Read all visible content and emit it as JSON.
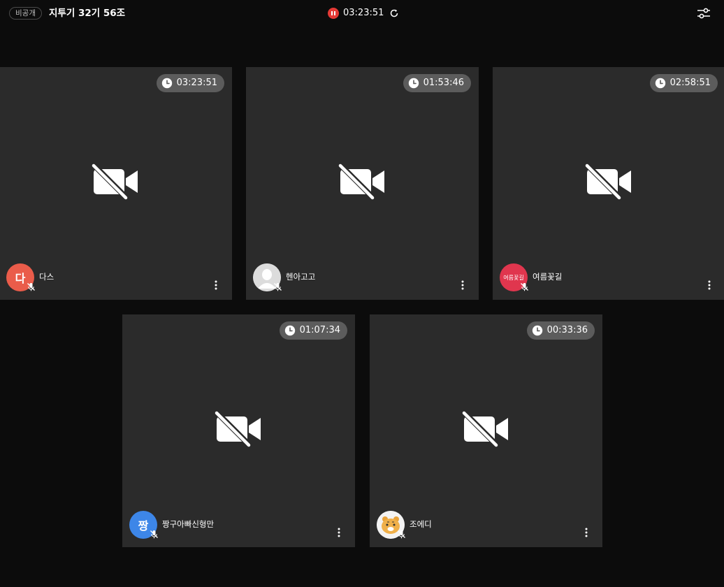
{
  "header": {
    "privacy_badge": "비공개",
    "room_title": "지투기 32기 56조",
    "recording_time": "03:23:51",
    "rec_icon": "pause-record-icon",
    "refresh_icon": "refresh-icon",
    "settings_icon": "sliders-icon"
  },
  "colors": {
    "background": "#0c0c0c",
    "tile": "#2b2b2b",
    "record": "#e53935",
    "timer_pill": "#5c5c5c"
  },
  "participants": [
    {
      "name": "다스",
      "timer": "03:23:51",
      "avatar_text": "다",
      "avatar_color": "#ea5c4a",
      "avatar_kind": "initial",
      "camera": "video-off-icon",
      "mic": "mic-off-icon"
    },
    {
      "name": "헨아고고",
      "timer": "01:53:46",
      "avatar_text": "",
      "avatar_color": "#dcdcdc",
      "avatar_kind": "default-person",
      "camera": "video-off-icon",
      "mic": "mic-off-icon"
    },
    {
      "name": "여름꽃길",
      "timer": "02:58:51",
      "avatar_text": "여름꽃길",
      "avatar_color": "#e0364e",
      "avatar_kind": "image",
      "camera": "video-off-icon",
      "mic": "mic-off-icon"
    },
    {
      "name": "짱구아빠신형만",
      "timer": "01:07:34",
      "avatar_text": "짱",
      "avatar_color": "#3d86e8",
      "avatar_kind": "initial",
      "camera": "video-off-icon",
      "mic": "mic-off-icon"
    },
    {
      "name": "조에디",
      "timer": "00:33:36",
      "avatar_text": "",
      "avatar_color": "#f3f3f3",
      "avatar_kind": "character",
      "camera": "video-off-icon",
      "mic": "mic-off-icon"
    }
  ]
}
